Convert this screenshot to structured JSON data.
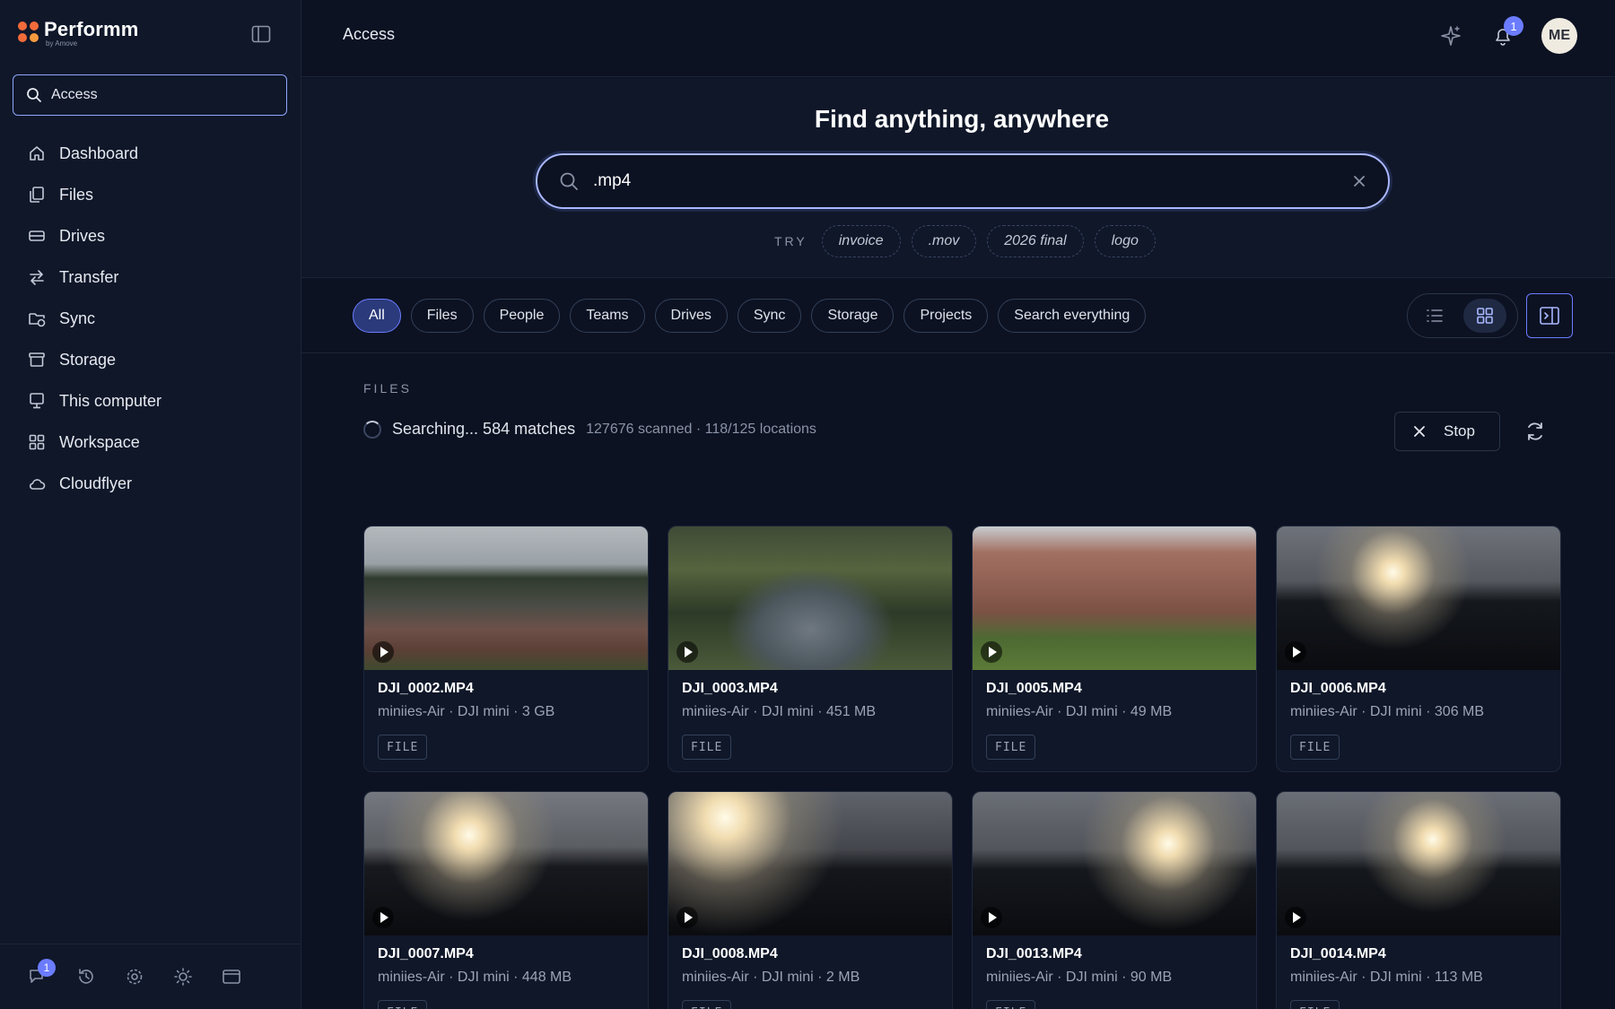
{
  "app": {
    "name": "Performm",
    "byline": "by Amove"
  },
  "topbar": {
    "title": "Access",
    "notifications_count": "1",
    "avatar_initials": "ME"
  },
  "sidebar": {
    "search_value": "Access",
    "items": [
      {
        "label": "Dashboard",
        "icon": "home-icon"
      },
      {
        "label": "Files",
        "icon": "files-icon"
      },
      {
        "label": "Drives",
        "icon": "drive-icon"
      },
      {
        "label": "Transfer",
        "icon": "transfer-icon"
      },
      {
        "label": "Sync",
        "icon": "sync-folder-icon"
      },
      {
        "label": "Storage",
        "icon": "storage-icon"
      },
      {
        "label": "This computer",
        "icon": "computer-icon"
      },
      {
        "label": "Workspace",
        "icon": "workspace-grid-icon"
      },
      {
        "label": "Cloudflyer",
        "icon": "cloud-icon"
      }
    ],
    "footer_badge": "1"
  },
  "hero": {
    "title": "Find anything, anywhere",
    "search_value": ".mp4",
    "try_label": "TRY",
    "suggestions": [
      "invoice",
      ".mov",
      "2026 final",
      "logo"
    ]
  },
  "filters": {
    "pills": [
      "All",
      "Files",
      "People",
      "Teams",
      "Drives",
      "Sync",
      "Storage",
      "Projects",
      "Search everything"
    ],
    "active": "All"
  },
  "results": {
    "section_label": "FILES",
    "status": "Searching... 584 matches",
    "status_detail": "127676 scanned · 118/125 locations",
    "stop_label": "Stop",
    "files": [
      {
        "name": "DJI_0002.MP4",
        "meta": "miniies-Air · DJI mini · 3 GB",
        "tag": "FILE",
        "thumb": "t-ruins"
      },
      {
        "name": "DJI_0003.MP4",
        "meta": "miniies-Air · DJI mini · 451 MB",
        "tag": "FILE",
        "thumb": "t-pond"
      },
      {
        "name": "DJI_0005.MP4",
        "meta": "miniies-Air · DJI mini · 49 MB",
        "tag": "FILE",
        "thumb": "t-mansion"
      },
      {
        "name": "DJI_0006.MP4",
        "meta": "miniies-Air · DJI mini · 306 MB",
        "tag": "FILE",
        "thumb": "t-sun1"
      },
      {
        "name": "DJI_0007.MP4",
        "meta": "miniies-Air · DJI mini · 448 MB",
        "tag": "FILE",
        "thumb": "t-sun2"
      },
      {
        "name": "DJI_0008.MP4",
        "meta": "miniies-Air · DJI mini · 2 MB",
        "tag": "FILE",
        "thumb": "t-sun3"
      },
      {
        "name": "DJI_0013.MP4",
        "meta": "miniies-Air · DJI mini · 90 MB",
        "tag": "FILE",
        "thumb": "t-sun4"
      },
      {
        "name": "DJI_0014.MP4",
        "meta": "miniies-Air · DJI mini · 113 MB",
        "tag": "FILE",
        "thumb": "t-sun5"
      }
    ]
  },
  "colors": {
    "accent": "#6b7cff",
    "background": "#0c1222",
    "brand": "#f26b3a"
  }
}
